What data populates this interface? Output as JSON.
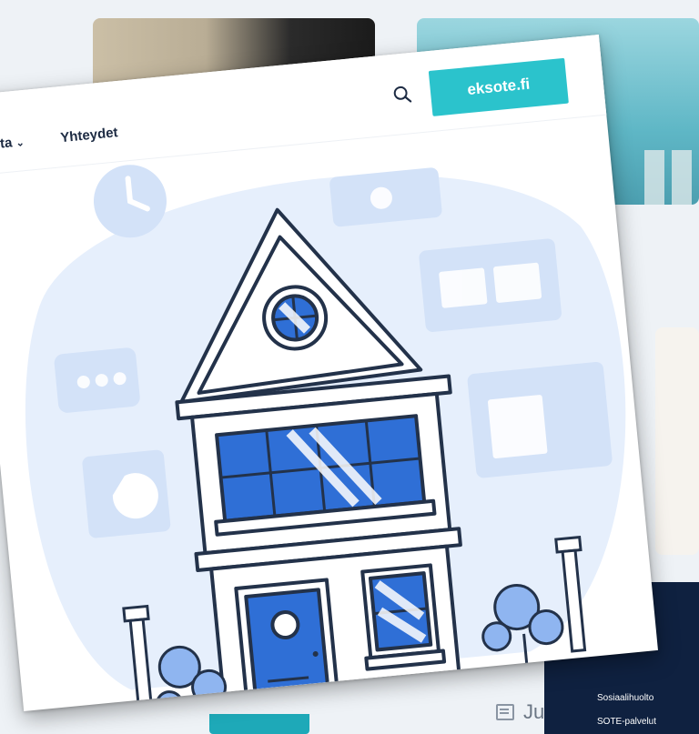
{
  "nav": {
    "items": [
      {
        "label": "taista",
        "has_dropdown": true,
        "icon": "chevron-down-icon"
      },
      {
        "label": "Yhteydet",
        "has_dropdown": false
      }
    ]
  },
  "header": {
    "search_icon": "search-icon",
    "cta_label": "eksote.fi",
    "cta_color": "#2bc3cc"
  },
  "background": {
    "footer_links": [
      "Sosiaalihuolto",
      "SOTE-palvelut"
    ],
    "bottom_text": "Ju",
    "bottom_icon": "calendar-icon"
  },
  "illustration": {
    "subject": "house-illustration",
    "accent_color": "#2f6fd6",
    "light_color": "#dbe8fb"
  }
}
